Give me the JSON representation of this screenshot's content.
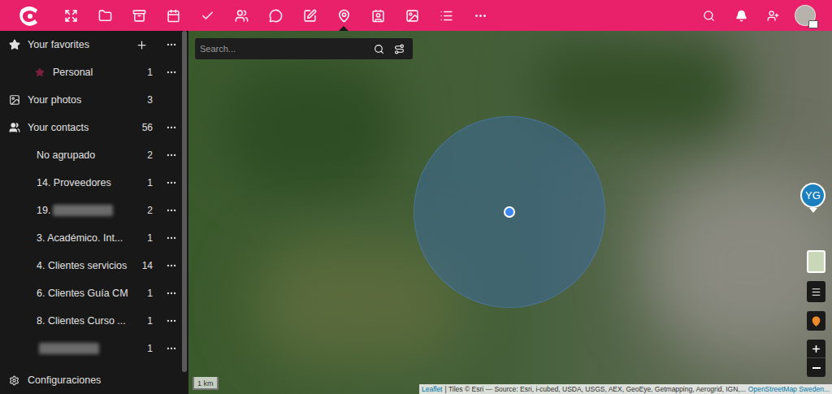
{
  "top_bar": {
    "apps": [
      {
        "selected": false
      },
      {
        "selected": false
      },
      {
        "selected": false
      },
      {
        "selected": false
      },
      {
        "selected": false
      },
      {
        "selected": false
      },
      {
        "selected": false
      },
      {
        "selected": false
      },
      {
        "selected": true
      },
      {
        "selected": false
      },
      {
        "selected": false
      },
      {
        "selected": false
      },
      {
        "selected": false
      }
    ]
  },
  "sidebar": {
    "items": [
      {
        "kind": "section",
        "label": "Your favorites",
        "count": "",
        "add": true,
        "menu": true,
        "starred": false,
        "blurred": false
      },
      {
        "kind": "group",
        "label": "Personal",
        "count": "1",
        "add": false,
        "menu": true,
        "starred": true,
        "blurred": false
      },
      {
        "kind": "section",
        "label": "Your photos",
        "count": "3",
        "add": false,
        "menu": false,
        "starred": false,
        "blurred": false
      },
      {
        "kind": "section",
        "label": "Your contacts",
        "count": "56",
        "add": false,
        "menu": true,
        "starred": false,
        "blurred": false
      },
      {
        "kind": "group",
        "label": "No agrupado",
        "count": "2",
        "add": false,
        "menu": true,
        "starred": false,
        "blurred": false
      },
      {
        "kind": "group",
        "label": "14. Proveedores",
        "count": "1",
        "add": false,
        "menu": true,
        "starred": false,
        "blurred": false
      },
      {
        "kind": "group",
        "label": "19.",
        "count": "2",
        "add": false,
        "menu": true,
        "starred": false,
        "blurred": true
      },
      {
        "kind": "group",
        "label": "3. Académico. Int...",
        "count": "1",
        "add": false,
        "menu": true,
        "starred": false,
        "blurred": false
      },
      {
        "kind": "group",
        "label": "4. Clientes servicios",
        "count": "14",
        "add": false,
        "menu": true,
        "starred": false,
        "blurred": false
      },
      {
        "kind": "group",
        "label": "6. Clientes Guía CM",
        "count": "1",
        "add": false,
        "menu": true,
        "starred": false,
        "blurred": false
      },
      {
        "kind": "group",
        "label": "8. Clientes Curso ...",
        "count": "1",
        "add": false,
        "menu": true,
        "starred": false,
        "blurred": false
      },
      {
        "kind": "group",
        "label": "",
        "count": "1",
        "add": false,
        "menu": true,
        "starred": false,
        "blurred": true
      }
    ],
    "settings": "Configuraciones"
  },
  "map": {
    "search": {
      "placeholder": "Search..."
    },
    "markers": [
      {
        "label": "YG"
      }
    ],
    "scale": "1 km",
    "attribution": {
      "leaflet": "Leaflet",
      "tiles": "| Tiles © Esri — Source: Esri, i-cubed, USDA, USGS, AEX, GeoEye, Getmapping, Aerogrid, IGN,...",
      "osm": "OpenStreetMap Sweden..."
    }
  }
}
